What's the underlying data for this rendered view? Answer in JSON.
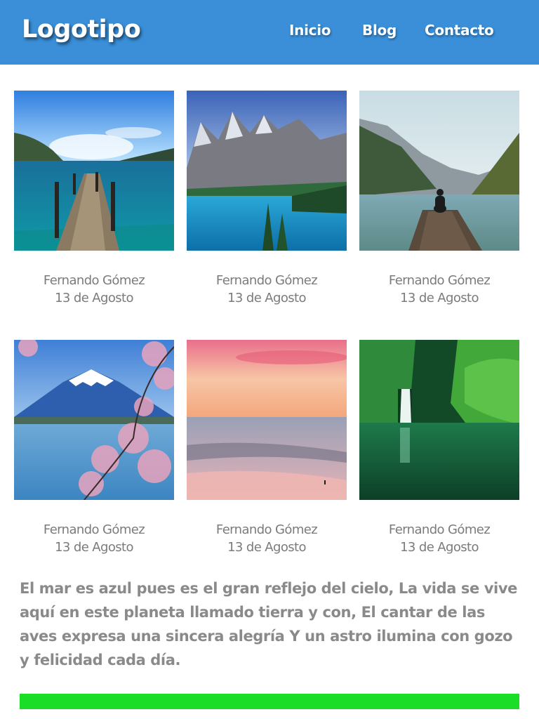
{
  "header": {
    "logo": "Logotipo",
    "nav": [
      {
        "label": "Inicio"
      },
      {
        "label": "Blog"
      },
      {
        "label": "Contacto"
      }
    ]
  },
  "gallery": [
    {
      "image": "pier-lake-image",
      "author": "Fernando Gómez",
      "date": "13 de Agosto"
    },
    {
      "image": "mountain-lake-image",
      "author": "Fernando Gómez",
      "date": "13 de Agosto"
    },
    {
      "image": "person-on-pier-image",
      "author": "Fernando Gómez",
      "date": "13 de Agosto"
    },
    {
      "image": "mount-fuji-image",
      "author": "Fernando Gómez",
      "date": "13 de Agosto"
    },
    {
      "image": "beach-sunset-image",
      "author": "Fernando Gómez",
      "date": "13 de Agosto"
    },
    {
      "image": "waterfall-image",
      "author": "Fernando Gómez",
      "date": "13 de Agosto"
    }
  ],
  "paragraph": "El mar es azul pues es el gran reflejo del cielo, La vida se vive aquí en este planeta llamado tierra y con, El cantar de las aves expresa una sincera alegría Y un astro ilumina con gozo y felicidad cada día.",
  "colors": {
    "header": "#3a8fd8",
    "text_gray": "#7b7b7b",
    "footer_bar": "#19dd26"
  }
}
